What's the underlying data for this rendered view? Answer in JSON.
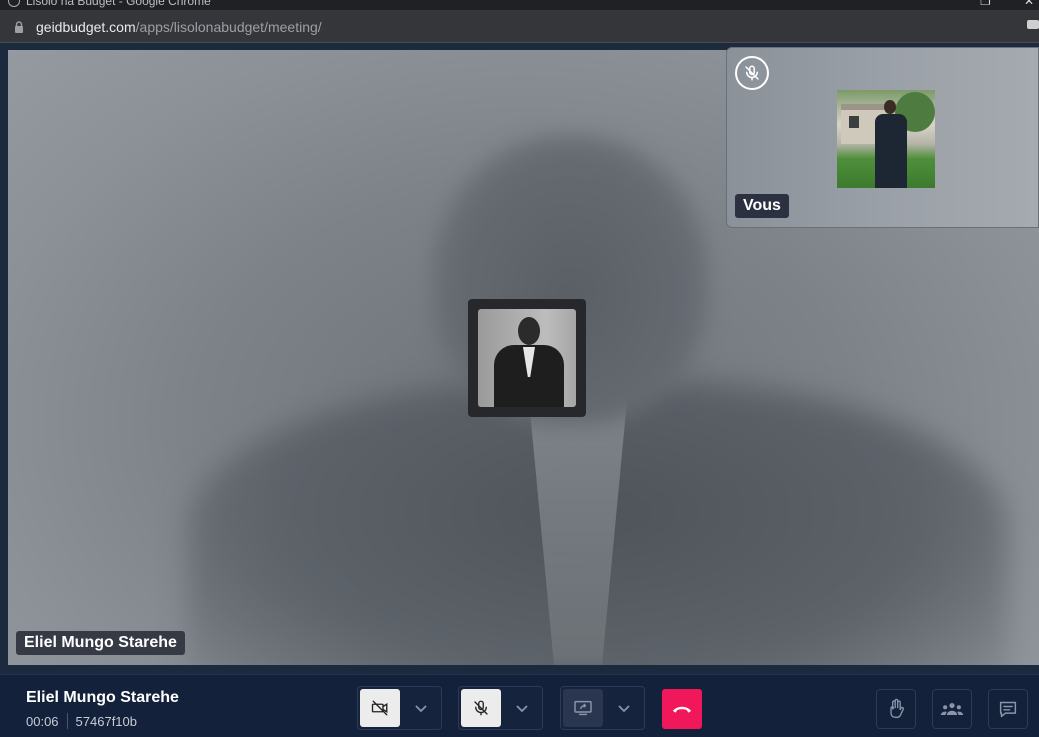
{
  "browser": {
    "window_title": "Lisolo na Budget - Google Chrome",
    "url_host": "geidbudget.com",
    "url_path": "/apps/lisolonabudget/meeting/"
  },
  "stage": {
    "main_participant_name": "Eliel Mungo Starehe",
    "self_label": "Vous"
  },
  "toolbar": {
    "meeting_title": "Eliel Mungo Starehe",
    "elapsed": "00:06",
    "meeting_code": "57467f10b",
    "controls": {
      "camera_icon": "camera-off-icon",
      "mic_icon": "mic-off-icon",
      "share_icon": "screen-share-icon",
      "hangup_icon": "phone-hangup-icon",
      "hand_icon": "raise-hand-icon",
      "participants_icon": "participants-icon",
      "chat_icon": "chat-icon"
    },
    "colors": {
      "hangup": "#f0185a",
      "toolbar_bg": "#13213a"
    }
  }
}
